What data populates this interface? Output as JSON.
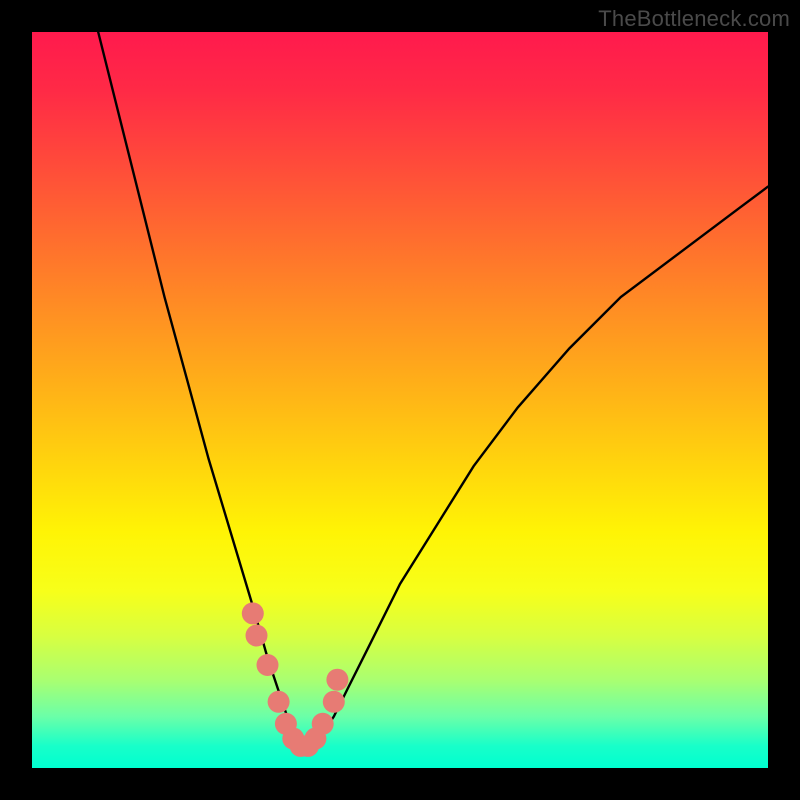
{
  "watermark": "TheBottleneck.com",
  "chart_data": {
    "type": "line",
    "title": "",
    "xlabel": "",
    "ylabel": "",
    "xlim": [
      0,
      100
    ],
    "ylim": [
      0,
      100
    ],
    "series": [
      {
        "name": "bottleneck-curve",
        "x": [
          9,
          12,
          15,
          18,
          21,
          24,
          27,
          30,
          32,
          34,
          35,
          36,
          37,
          38,
          39,
          41,
          43,
          46,
          50,
          55,
          60,
          66,
          73,
          80,
          88,
          96,
          100
        ],
        "values": [
          100,
          88,
          76,
          64,
          53,
          42,
          32,
          22,
          15,
          9,
          6,
          4,
          3,
          3,
          4,
          7,
          11,
          17,
          25,
          33,
          41,
          49,
          57,
          64,
          70,
          76,
          79
        ]
      },
      {
        "name": "highlight-dots",
        "x": [
          30,
          30.5,
          32,
          33.5,
          34.5,
          35.5,
          36.5,
          37.5,
          38.5,
          39.5,
          41,
          41.5
        ],
        "values": [
          21,
          18,
          14,
          9,
          6,
          4,
          3,
          3,
          4,
          6,
          9,
          12
        ]
      }
    ],
    "colors": {
      "curve": "#000000",
      "dots": "#e77b74",
      "background_top": "#ff1a4d",
      "background_bottom": "#00ffd0"
    }
  }
}
